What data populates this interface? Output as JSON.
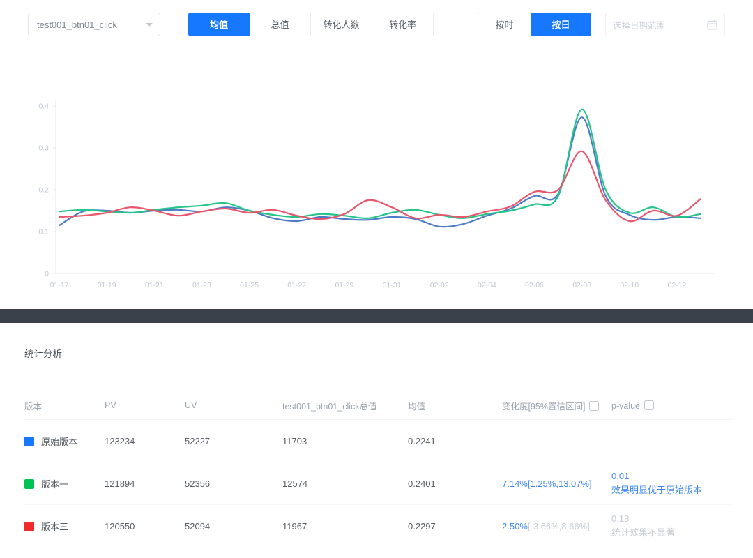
{
  "toolbar": {
    "metric_select": {
      "value": "test001_btn01_click"
    },
    "metric_tabs": [
      {
        "label": "均值",
        "active": true
      },
      {
        "label": "总值",
        "active": false
      },
      {
        "label": "转化人数",
        "active": false
      },
      {
        "label": "转化率",
        "active": false
      }
    ],
    "granularity_tabs": [
      {
        "label": "按时",
        "active": false
      },
      {
        "label": "按日",
        "active": true
      }
    ],
    "date_range": {
      "placeholder": "选择日期范围"
    }
  },
  "chart_data": {
    "type": "line",
    "title": "",
    "xlabel": "",
    "ylabel": "",
    "ylim": [
      0,
      0.4
    ],
    "yticks": [
      0,
      0.1,
      0.2,
      0.3,
      0.4
    ],
    "grid": false,
    "legend_position": "none",
    "x": [
      "01-17",
      "01-18",
      "01-19",
      "01-20",
      "01-21",
      "01-22",
      "01-23",
      "01-24",
      "01-25",
      "01-26",
      "01-27",
      "01-28",
      "01-29",
      "01-30",
      "01-31",
      "02-01",
      "02-02",
      "02-03",
      "02-04",
      "02-05",
      "02-06",
      "02-07",
      "02-08",
      "02-09",
      "02-10",
      "02-11",
      "02-12",
      "02-13"
    ],
    "x_tick_every": 2,
    "series": [
      {
        "name": "原始版本",
        "color": "#4d7cc7",
        "values": [
          0.115,
          0.148,
          0.15,
          0.145,
          0.15,
          0.152,
          0.148,
          0.158,
          0.15,
          0.132,
          0.125,
          0.135,
          0.13,
          0.128,
          0.135,
          0.13,
          0.112,
          0.118,
          0.138,
          0.155,
          0.185,
          0.19,
          0.373,
          0.185,
          0.14,
          0.128,
          0.135,
          0.132
        ]
      },
      {
        "name": "版本一",
        "color": "#25c489",
        "values": [
          0.148,
          0.152,
          0.148,
          0.145,
          0.152,
          0.158,
          0.162,
          0.168,
          0.15,
          0.14,
          0.135,
          0.142,
          0.138,
          0.132,
          0.145,
          0.152,
          0.14,
          0.132,
          0.142,
          0.15,
          0.165,
          0.185,
          0.392,
          0.2,
          0.145,
          0.158,
          0.135,
          0.142
        ]
      },
      {
        "name": "版本三",
        "color": "#e8566b",
        "values": [
          0.135,
          0.138,
          0.145,
          0.158,
          0.15,
          0.138,
          0.148,
          0.155,
          0.145,
          0.152,
          0.138,
          0.13,
          0.142,
          0.175,
          0.158,
          0.132,
          0.14,
          0.135,
          0.148,
          0.16,
          0.195,
          0.2,
          0.292,
          0.175,
          0.125,
          0.15,
          0.138,
          0.178
        ]
      }
    ]
  },
  "stats": {
    "title": "统计分析",
    "table": {
      "headers": [
        {
          "label": "版本",
          "icon": false
        },
        {
          "label": "PV",
          "icon": false
        },
        {
          "label": "UV",
          "icon": false
        },
        {
          "label": "test001_btn01_click总值",
          "icon": false
        },
        {
          "label": "均值",
          "icon": false
        },
        {
          "label": "变化度[95%置信区间]",
          "icon": true
        },
        {
          "label": "p-value",
          "icon": true
        }
      ],
      "rows": [
        {
          "color": "#1677ff",
          "version": "原始版本",
          "pv": "123234",
          "uv": "52227",
          "total": "11703",
          "mean": "0.2241",
          "change": "",
          "ci": "",
          "ci_muted": false,
          "p": "",
          "verdict": "",
          "p_muted": false
        },
        {
          "color": "#00c250",
          "version": "版本一",
          "pv": "121894",
          "uv": "52356",
          "total": "12574",
          "mean": "0.2401",
          "change": "7.14%",
          "ci": "[1.25%,13.07%]",
          "ci_muted": false,
          "p": "0.01",
          "verdict": "效果明显优于原始版本",
          "p_muted": false
        },
        {
          "color": "#f02a2a",
          "version": "版本三",
          "pv": "120550",
          "uv": "52094",
          "total": "11967",
          "mean": "0.2297",
          "change": "2.50%",
          "ci": "[-3.66%,8.66%]",
          "ci_muted": true,
          "p": "0.18",
          "verdict": "统计效果不显著",
          "p_muted": true
        }
      ]
    }
  },
  "colors": {
    "accent_blue": "#1677ff",
    "link_blue": "#3d87f5",
    "muted_gray": "#c7cdd4",
    "band_dark": "#3a414b",
    "axis_gray": "#e2e5ea",
    "tick_text": "#c2c8d2"
  }
}
